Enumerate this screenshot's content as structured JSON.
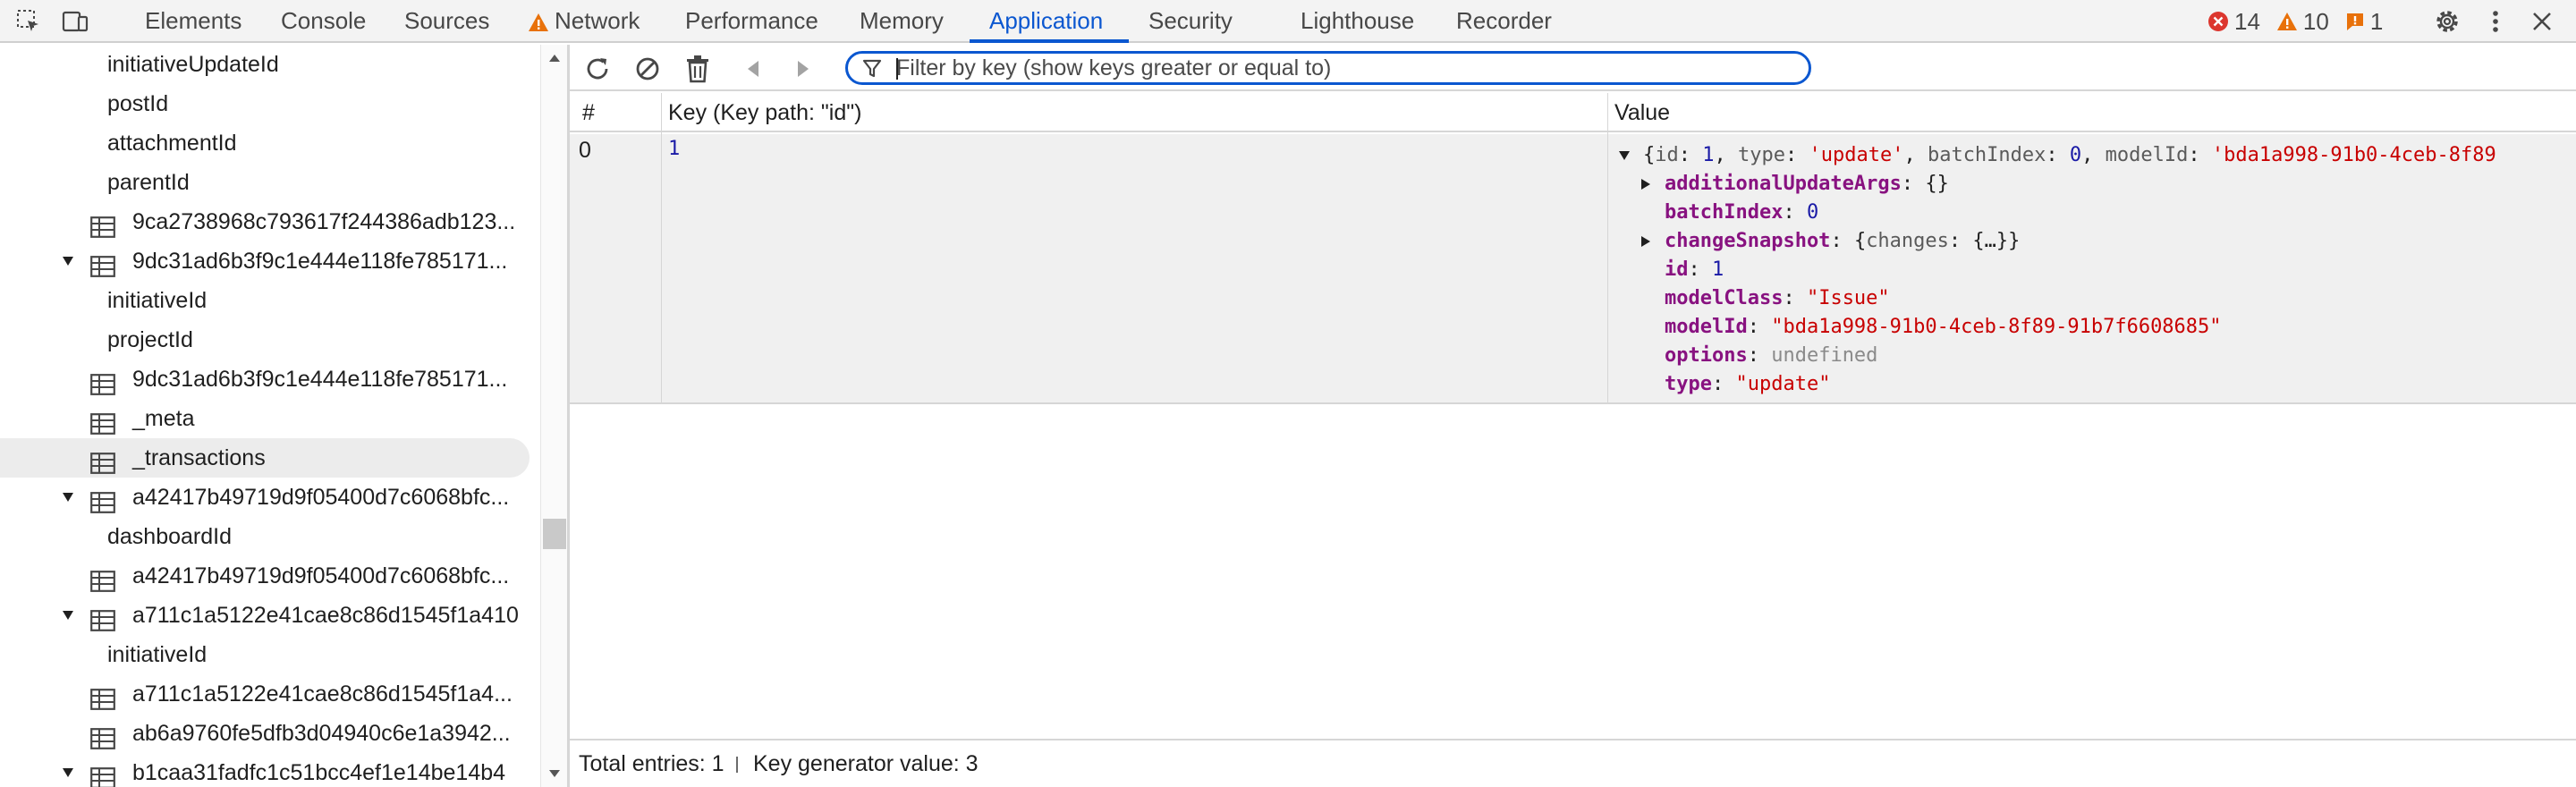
{
  "tabs": [
    {
      "label": "Elements"
    },
    {
      "label": "Console"
    },
    {
      "label": "Sources"
    },
    {
      "label": "Network"
    },
    {
      "label": "Performance"
    },
    {
      "label": "Memory"
    },
    {
      "label": "Application"
    },
    {
      "label": "Security"
    },
    {
      "label": "Lighthouse"
    },
    {
      "label": "Recorder"
    }
  ],
  "active_tab": "Application",
  "counters": {
    "errors": "14",
    "warnings": "10",
    "issues": "1"
  },
  "tree": {
    "items": [
      {
        "label": "initiativeUpdateId",
        "kind": "index"
      },
      {
        "label": "postId",
        "kind": "index"
      },
      {
        "label": "attachmentId",
        "kind": "index"
      },
      {
        "label": "parentId",
        "kind": "index"
      },
      {
        "label": "9ca2738968c793617f244386adb123...",
        "kind": "store"
      },
      {
        "label": "9dc31ad6b3f9c1e444e118fe785171...",
        "kind": "store-expanded"
      },
      {
        "label": "initiativeId",
        "kind": "index"
      },
      {
        "label": "projectId",
        "kind": "index"
      },
      {
        "label": "9dc31ad6b3f9c1e444e118fe785171...",
        "kind": "store"
      },
      {
        "label": "_meta",
        "kind": "store"
      },
      {
        "label": "_transactions",
        "kind": "store-selected"
      },
      {
        "label": "a42417b49719d9f05400d7c6068bfc...",
        "kind": "store-expanded"
      },
      {
        "label": "dashboardId",
        "kind": "index"
      },
      {
        "label": "a42417b49719d9f05400d7c6068bfc...",
        "kind": "store"
      },
      {
        "label": "a711c1a5122e41cae8c86d1545f1a410",
        "kind": "store-expanded"
      },
      {
        "label": "initiativeId",
        "kind": "index"
      },
      {
        "label": "a711c1a5122e41cae8c86d1545f1a4...",
        "kind": "store"
      },
      {
        "label": "ab6a9760fe5dfb3d04940c6e1a3942...",
        "kind": "store"
      },
      {
        "label": "b1caa31fadfc1c51bcc4ef1e14be14b4",
        "kind": "store-expanded"
      }
    ]
  },
  "filter": {
    "placeholder": "Filter by key (show keys greater or equal to)",
    "value": ""
  },
  "grid": {
    "headers": {
      "index": "#",
      "key": "Key (Key path: \"id\")",
      "value": "Value"
    },
    "row": {
      "index": "0",
      "key": "1",
      "preview": {
        "open": "{",
        "id_key": "id",
        "id_val": "1",
        "type_key": "type",
        "type_val": "'update'",
        "batch_key": "batchIndex",
        "batch_val": "0",
        "model_key": "modelId",
        "model_val": "'bda1a998-91b0-4ceb-8f89"
      },
      "props": [
        {
          "key": "additionalUpdateArgs",
          "rest": "{}",
          "expandable": true
        },
        {
          "key": "batchIndex",
          "num": "0"
        },
        {
          "key": "changeSnapshot",
          "snapshot_open": "{",
          "snapshot_key": "changes",
          "snapshot_rest": "{…}}",
          "expandable": true
        },
        {
          "key": "id",
          "num": "1"
        },
        {
          "key": "modelClass",
          "str": "\"Issue\""
        },
        {
          "key": "modelId",
          "str": "\"bda1a998-91b0-4ceb-8f89-91b7f6608685\""
        },
        {
          "key": "options",
          "grey": "undefined"
        },
        {
          "key": "type",
          "str": "\"update\""
        }
      ]
    }
  },
  "status": {
    "total": "Total entries: 1",
    "keygen": "Key generator value: 3"
  }
}
